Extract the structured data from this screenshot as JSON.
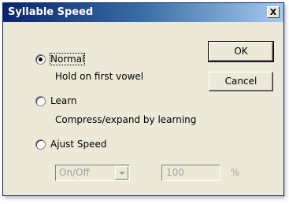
{
  "window": {
    "title": "Syllable Speed",
    "close_label": "X"
  },
  "options": [
    {
      "label": "Normal",
      "description": "Hold on first vowel",
      "checked": true
    },
    {
      "label": "Learn",
      "description": "Compress/expand by learning",
      "checked": false
    },
    {
      "label": "Ajust Speed",
      "description": "",
      "checked": false
    }
  ],
  "buttons": {
    "ok": "OK",
    "cancel": "Cancel"
  },
  "speed": {
    "mode_value": "On/Off",
    "value": "100",
    "unit": "%"
  }
}
